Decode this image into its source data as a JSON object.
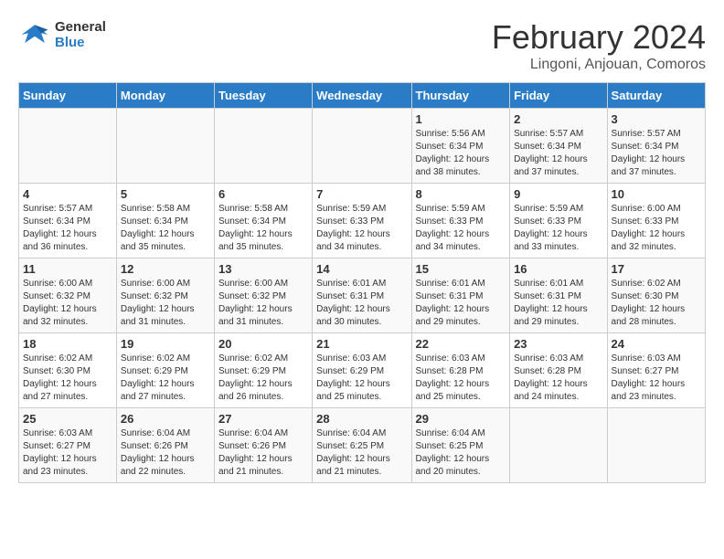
{
  "header": {
    "logo_line1": "General",
    "logo_line2": "Blue",
    "month_title": "February 2024",
    "subtitle": "Lingoni, Anjouan, Comoros"
  },
  "days_of_week": [
    "Sunday",
    "Monday",
    "Tuesday",
    "Wednesday",
    "Thursday",
    "Friday",
    "Saturday"
  ],
  "weeks": [
    [
      {
        "day": "",
        "info": ""
      },
      {
        "day": "",
        "info": ""
      },
      {
        "day": "",
        "info": ""
      },
      {
        "day": "",
        "info": ""
      },
      {
        "day": "1",
        "info": "Sunrise: 5:56 AM\nSunset: 6:34 PM\nDaylight: 12 hours\nand 38 minutes."
      },
      {
        "day": "2",
        "info": "Sunrise: 5:57 AM\nSunset: 6:34 PM\nDaylight: 12 hours\nand 37 minutes."
      },
      {
        "day": "3",
        "info": "Sunrise: 5:57 AM\nSunset: 6:34 PM\nDaylight: 12 hours\nand 37 minutes."
      }
    ],
    [
      {
        "day": "4",
        "info": "Sunrise: 5:57 AM\nSunset: 6:34 PM\nDaylight: 12 hours\nand 36 minutes."
      },
      {
        "day": "5",
        "info": "Sunrise: 5:58 AM\nSunset: 6:34 PM\nDaylight: 12 hours\nand 35 minutes."
      },
      {
        "day": "6",
        "info": "Sunrise: 5:58 AM\nSunset: 6:34 PM\nDaylight: 12 hours\nand 35 minutes."
      },
      {
        "day": "7",
        "info": "Sunrise: 5:59 AM\nSunset: 6:33 PM\nDaylight: 12 hours\nand 34 minutes."
      },
      {
        "day": "8",
        "info": "Sunrise: 5:59 AM\nSunset: 6:33 PM\nDaylight: 12 hours\nand 34 minutes."
      },
      {
        "day": "9",
        "info": "Sunrise: 5:59 AM\nSunset: 6:33 PM\nDaylight: 12 hours\nand 33 minutes."
      },
      {
        "day": "10",
        "info": "Sunrise: 6:00 AM\nSunset: 6:33 PM\nDaylight: 12 hours\nand 32 minutes."
      }
    ],
    [
      {
        "day": "11",
        "info": "Sunrise: 6:00 AM\nSunset: 6:32 PM\nDaylight: 12 hours\nand 32 minutes."
      },
      {
        "day": "12",
        "info": "Sunrise: 6:00 AM\nSunset: 6:32 PM\nDaylight: 12 hours\nand 31 minutes."
      },
      {
        "day": "13",
        "info": "Sunrise: 6:00 AM\nSunset: 6:32 PM\nDaylight: 12 hours\nand 31 minutes."
      },
      {
        "day": "14",
        "info": "Sunrise: 6:01 AM\nSunset: 6:31 PM\nDaylight: 12 hours\nand 30 minutes."
      },
      {
        "day": "15",
        "info": "Sunrise: 6:01 AM\nSunset: 6:31 PM\nDaylight: 12 hours\nand 29 minutes."
      },
      {
        "day": "16",
        "info": "Sunrise: 6:01 AM\nSunset: 6:31 PM\nDaylight: 12 hours\nand 29 minutes."
      },
      {
        "day": "17",
        "info": "Sunrise: 6:02 AM\nSunset: 6:30 PM\nDaylight: 12 hours\nand 28 minutes."
      }
    ],
    [
      {
        "day": "18",
        "info": "Sunrise: 6:02 AM\nSunset: 6:30 PM\nDaylight: 12 hours\nand 27 minutes."
      },
      {
        "day": "19",
        "info": "Sunrise: 6:02 AM\nSunset: 6:29 PM\nDaylight: 12 hours\nand 27 minutes."
      },
      {
        "day": "20",
        "info": "Sunrise: 6:02 AM\nSunset: 6:29 PM\nDaylight: 12 hours\nand 26 minutes."
      },
      {
        "day": "21",
        "info": "Sunrise: 6:03 AM\nSunset: 6:29 PM\nDaylight: 12 hours\nand 25 minutes."
      },
      {
        "day": "22",
        "info": "Sunrise: 6:03 AM\nSunset: 6:28 PM\nDaylight: 12 hours\nand 25 minutes."
      },
      {
        "day": "23",
        "info": "Sunrise: 6:03 AM\nSunset: 6:28 PM\nDaylight: 12 hours\nand 24 minutes."
      },
      {
        "day": "24",
        "info": "Sunrise: 6:03 AM\nSunset: 6:27 PM\nDaylight: 12 hours\nand 23 minutes."
      }
    ],
    [
      {
        "day": "25",
        "info": "Sunrise: 6:03 AM\nSunset: 6:27 PM\nDaylight: 12 hours\nand 23 minutes."
      },
      {
        "day": "26",
        "info": "Sunrise: 6:04 AM\nSunset: 6:26 PM\nDaylight: 12 hours\nand 22 minutes."
      },
      {
        "day": "27",
        "info": "Sunrise: 6:04 AM\nSunset: 6:26 PM\nDaylight: 12 hours\nand 21 minutes."
      },
      {
        "day": "28",
        "info": "Sunrise: 6:04 AM\nSunset: 6:25 PM\nDaylight: 12 hours\nand 21 minutes."
      },
      {
        "day": "29",
        "info": "Sunrise: 6:04 AM\nSunset: 6:25 PM\nDaylight: 12 hours\nand 20 minutes."
      },
      {
        "day": "",
        "info": ""
      },
      {
        "day": "",
        "info": ""
      }
    ]
  ]
}
